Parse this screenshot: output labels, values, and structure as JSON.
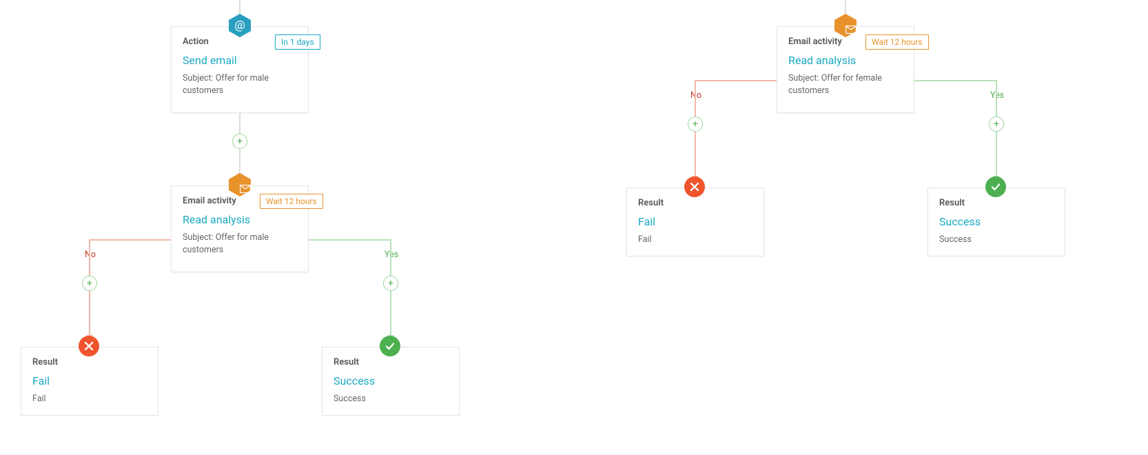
{
  "left": {
    "action": {
      "category": "Action",
      "title": "Send email",
      "subject": "Subject: Offer for male customers",
      "badge": "In 1 days"
    },
    "activity": {
      "category": "Email activity",
      "title": "Read analysis",
      "subject": "Subject: Offer for male customers",
      "badge": "Wait 12 hours"
    },
    "branch_no": "No",
    "branch_yes": "Yes",
    "fail": {
      "category": "Result",
      "title": "Fail",
      "sub": "Fail"
    },
    "success": {
      "category": "Result",
      "title": "Success",
      "sub": "Success"
    }
  },
  "right": {
    "activity": {
      "category": "Email activity",
      "title": "Read analysis",
      "subject": "Subject: Offer for female customers",
      "badge": "Wait 12 hours"
    },
    "branch_no": "No",
    "branch_yes": "Yes",
    "fail": {
      "category": "Result",
      "title": "Fail",
      "sub": "Fail"
    },
    "success": {
      "category": "Result",
      "title": "Success",
      "sub": "Success"
    }
  },
  "glyph": {
    "plus": "+"
  }
}
